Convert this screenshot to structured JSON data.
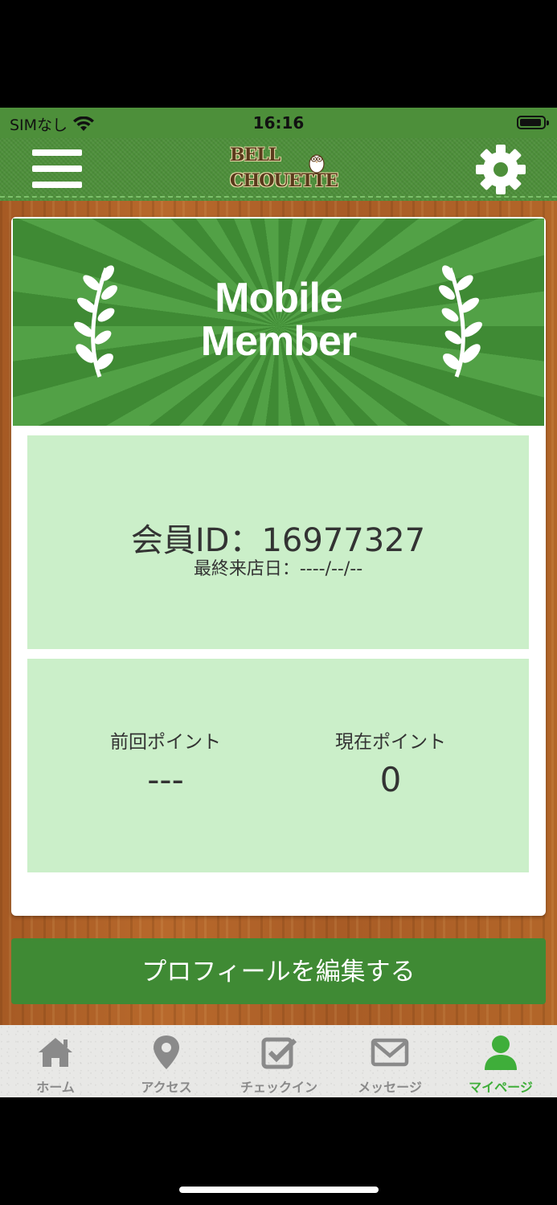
{
  "status_bar": {
    "carrier": "SIMなし",
    "time": "16:16"
  },
  "header": {
    "logo_line1": "BELL",
    "logo_line2": "CHOUETTE"
  },
  "banner": {
    "title_line1": "Mobile",
    "title_line2": "Member"
  },
  "member": {
    "id_text": "会員ID：16977327",
    "last_visit_text": "最終来店日：----/--/--"
  },
  "points": {
    "previous_label": "前回ポイント",
    "previous_value": "---",
    "current_label": "現在ポイント",
    "current_value": "0"
  },
  "edit_profile_label": "プロフィールを編集する",
  "tabs": [
    {
      "label": "ホーム",
      "icon": "home-icon"
    },
    {
      "label": "アクセス",
      "icon": "map-pin-icon"
    },
    {
      "label": "チェックイン",
      "icon": "checkbox-icon"
    },
    {
      "label": "メッセージ",
      "icon": "envelope-icon"
    },
    {
      "label": "マイページ",
      "icon": "user-icon",
      "active": true
    }
  ],
  "colors": {
    "primary_green": "#3f8a34",
    "panel_green": "#cbefc9",
    "active_tab": "#3fae3a"
  }
}
